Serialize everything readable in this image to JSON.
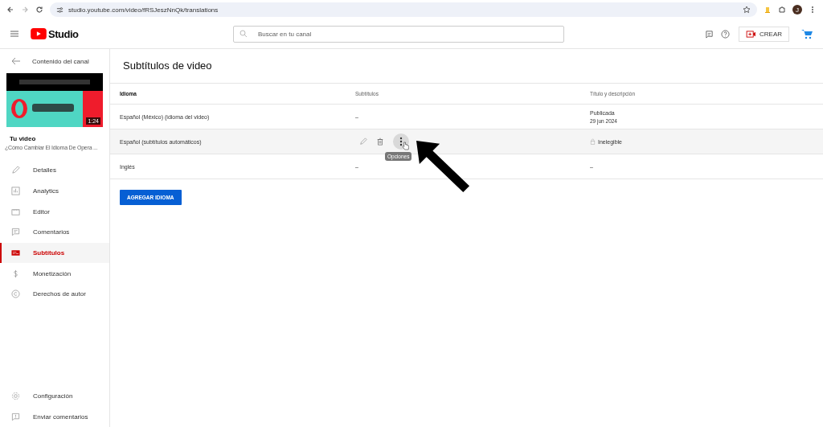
{
  "browser": {
    "url": "studio.youtube.com/video/fRSJeszNnQk/translations",
    "avatar": "J"
  },
  "header": {
    "logo": "Studio",
    "search": {
      "placeholder": "Buscar en tu canal"
    },
    "create_button": "CREAR"
  },
  "sidebar": {
    "back_label": "Contenido del canal",
    "thumbnail": {
      "kind": "picture",
      "duration": "1:24"
    },
    "section_label": "Tu video",
    "video_title": "¿Cómo Cambiar El Idioma De Opera ...",
    "items": [
      {
        "label": "Detalles",
        "selected": false
      },
      {
        "label": "Analytics",
        "selected": false
      },
      {
        "label": "Editor",
        "selected": false
      },
      {
        "label": "Comentarios",
        "selected": false
      },
      {
        "label": "Subtítulos",
        "selected": true
      },
      {
        "label": "Monetización",
        "selected": false
      },
      {
        "label": "Derechos de autor",
        "selected": false
      }
    ],
    "footer_items": [
      {
        "label": "Configuración"
      },
      {
        "label": "Enviar comentarios"
      }
    ]
  },
  "page": {
    "title": "Subtítulos de video",
    "columns": [
      "Idioma",
      "Subtítulos",
      "Título y descripción"
    ],
    "rows": [
      {
        "language": "Español (México) (idioma del video)",
        "hovered": false,
        "subtitles": "–",
        "title_status": "Publicada",
        "title_date": "29 jun 2024"
      },
      {
        "language": "Español (subtítulos automáticos)",
        "hovered": true,
        "tooltip": "Opciones",
        "title_status": "Inelegible",
        "locked": true
      },
      {
        "language": "Inglés",
        "hovered": false,
        "subtitles": "–",
        "title_status": "–"
      }
    ],
    "add_button": "AGREGAR IDIOMA"
  }
}
